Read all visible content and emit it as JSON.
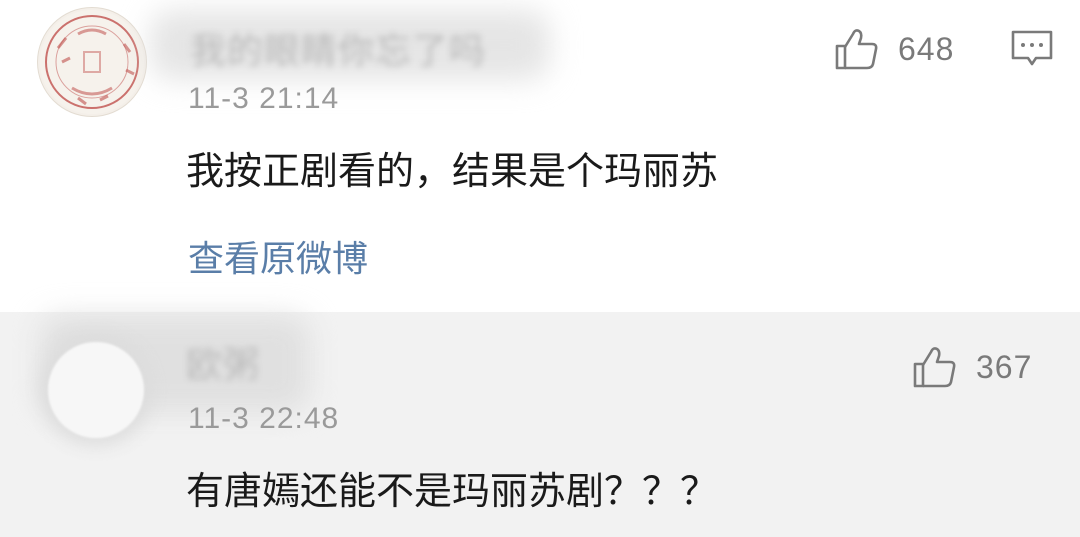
{
  "comments": [
    {
      "username": "我的眼睛你忘了吗",
      "timestamp": "11-3 21:14",
      "text": "我按正剧看的，结果是个玛丽苏",
      "like_count": "648",
      "view_original_label": "查看原微博",
      "avatar_icon": "seal-stamp-avatar",
      "reply_icon": "comment-bubble-icon"
    },
    {
      "username": "欧粥",
      "timestamp": "11-3 22:48",
      "text": "有唐嫣还能不是玛丽苏剧？？？",
      "like_count": "367",
      "avatar_icon": "blurred-avatar"
    }
  ],
  "colors": {
    "background_primary": "#ffffff",
    "background_secondary": "#f2f2f2",
    "text_main": "#1a1a1a",
    "text_meta": "#9a9a9a",
    "link": "#5a7ea8",
    "icon": "#7a7a7a",
    "seal_red": "#c0504d"
  }
}
